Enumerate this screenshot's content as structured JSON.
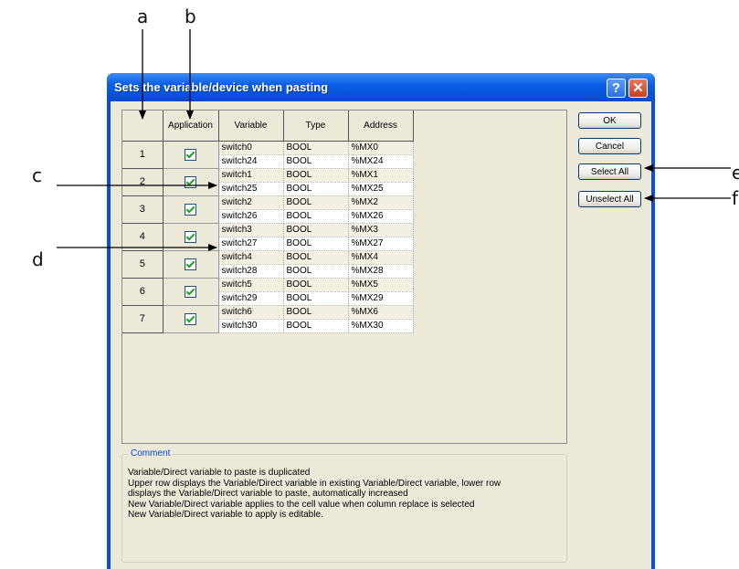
{
  "callouts": {
    "a": "a",
    "b": "b",
    "c": "c",
    "d": "d",
    "e": "e",
    "f": "f"
  },
  "dialog": {
    "title": "Sets the variable/device when pasting",
    "help_glyph": "?",
    "close_glyph": "✕"
  },
  "grid": {
    "headers": {
      "num": "",
      "application": "Application",
      "variable": "Variable",
      "type": "Type",
      "address": "Address"
    },
    "rows": [
      {
        "num": "1",
        "checked": true,
        "upper": {
          "variable": "switch0",
          "type": "BOOL",
          "address": "%MX0"
        },
        "lower": {
          "variable": "switch24",
          "type": "BOOL",
          "address": "%MX24"
        }
      },
      {
        "num": "2",
        "checked": true,
        "upper": {
          "variable": "switch1",
          "type": "BOOL",
          "address": "%MX1"
        },
        "lower": {
          "variable": "switch25",
          "type": "BOOL",
          "address": "%MX25"
        }
      },
      {
        "num": "3",
        "checked": true,
        "upper": {
          "variable": "switch2",
          "type": "BOOL",
          "address": "%MX2"
        },
        "lower": {
          "variable": "switch26",
          "type": "BOOL",
          "address": "%MX26"
        }
      },
      {
        "num": "4",
        "checked": true,
        "upper": {
          "variable": "switch3",
          "type": "BOOL",
          "address": "%MX3"
        },
        "lower": {
          "variable": "switch27",
          "type": "BOOL",
          "address": "%MX27"
        }
      },
      {
        "num": "5",
        "checked": true,
        "upper": {
          "variable": "switch4",
          "type": "BOOL",
          "address": "%MX4"
        },
        "lower": {
          "variable": "switch28",
          "type": "BOOL",
          "address": "%MX28"
        }
      },
      {
        "num": "6",
        "checked": true,
        "upper": {
          "variable": "switch5",
          "type": "BOOL",
          "address": "%MX5"
        },
        "lower": {
          "variable": "switch29",
          "type": "BOOL",
          "address": "%MX29"
        }
      },
      {
        "num": "7",
        "checked": true,
        "upper": {
          "variable": "switch6",
          "type": "BOOL",
          "address": "%MX6"
        },
        "lower": {
          "variable": "switch30",
          "type": "BOOL",
          "address": "%MX30"
        }
      }
    ]
  },
  "buttons": {
    "ok": "OK",
    "cancel": "Cancel",
    "select_all": "Select All",
    "unselect_all": "Unselect All"
  },
  "comment": {
    "label": "Comment",
    "lines": [
      "Variable/Direct variable to paste is duplicated",
      "Upper row displays the Variable/Direct variable in existing Variable/Direct variable, lower row",
      "displays the Variable/Direct variable to paste, automatically increased",
      "New Variable/Direct variable applies to the cell value when column replace is selected",
      "New Variable/Direct variable to apply is editable."
    ]
  },
  "colors": {
    "titlebar": "#0b5fe6",
    "face": "#ece9d8",
    "check": "#21a121",
    "link": "#0046d5"
  }
}
